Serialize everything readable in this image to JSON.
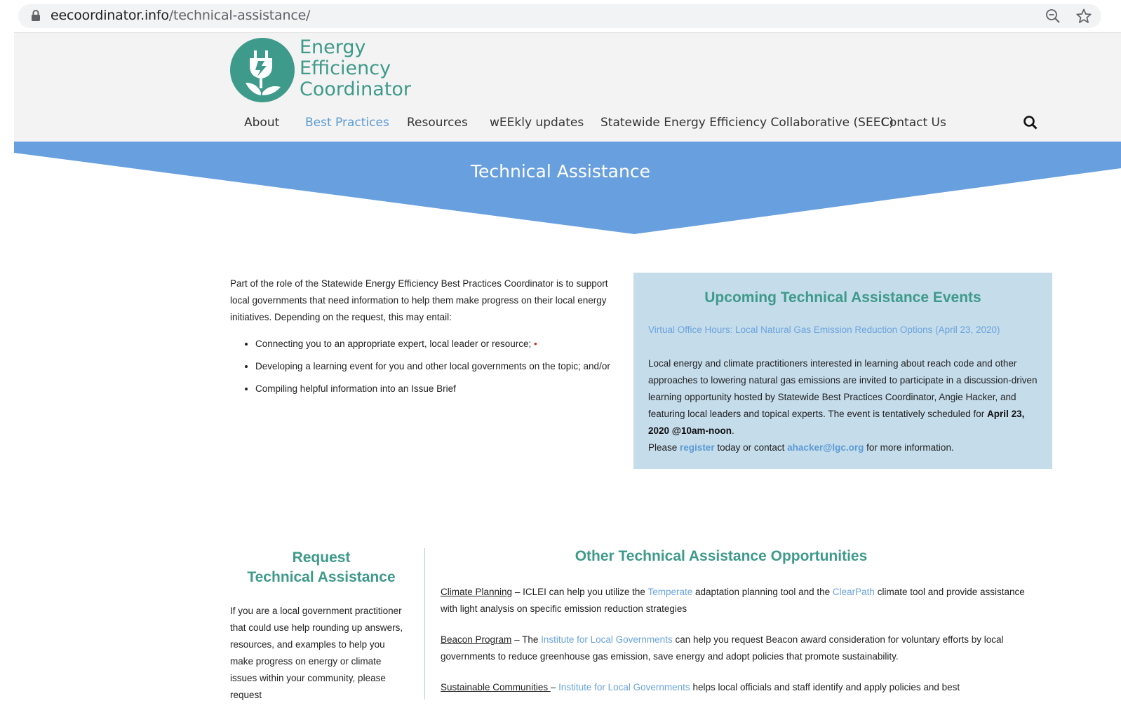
{
  "browser": {
    "url_domain": "eecoordinator.info",
    "url_path": "/technical-assistance/",
    "icons": [
      "lock-icon",
      "zoom-out-icon",
      "star-icon"
    ]
  },
  "header": {
    "logo_line1": "Energy",
    "logo_line2": "Efficiency",
    "logo_line3": "Coordinator",
    "nav": [
      {
        "label": "About"
      },
      {
        "label": "Best Practices",
        "active": true
      },
      {
        "label": "Resources"
      },
      {
        "label": "wEEkly updates"
      },
      {
        "label": "Statewide Energy Efficiency Collaborative (SEEC)"
      },
      {
        "label": "Contact Us"
      }
    ],
    "accent_color": "#3e9a8a",
    "active_nav_color": "#5b9bd5"
  },
  "banner": {
    "title": "Technical Assistance",
    "color": "#689fde"
  },
  "intro": {
    "paragraph": "Part of the role of the Statewide Energy Efficiency Best Practices Coordinator is to support local governments that need information to help them make progress on their local energy initiatives. Depending on the request, this may entail:",
    "bullets": [
      "Connecting you to an appropriate expert, local leader or resource;",
      "Developing a learning event for you and other local governments on the topic; and/or",
      "Compiling helpful information into an Issue Brief"
    ]
  },
  "events": {
    "title": "Upcoming Technical Assistance Events",
    "event_link": "Virtual Office Hours: Local Natural Gas Emission Reduction Options (April 23, 2020)",
    "body_text": "Local energy and climate practitioners interested in learning about reach code and other approaches to lowering natural gas emissions are invited to participate in a discussion-driven learning opportunity hosted by Statewide Best Practices Coordinator, Angie Hacker, and featuring local leaders and topical experts. The event is tentatively scheduled for",
    "date_bold": "April 23, 2020 @10am-noon",
    "period": ".",
    "please": "Please",
    "register": "register",
    "today_contact": "today or contact",
    "email": "ahacker@lgc.org",
    "more_info": "for more information.",
    "box_color": "#c5dcea"
  },
  "request": {
    "title_line1": "Request",
    "title_line2": "Technical Assistance",
    "body": "If you are a local government practitioner that could use help rounding up answers, resources, and examples to help you make progress on energy or climate issues within your community, please request"
  },
  "other": {
    "title": "Other Technical Assistance Opportunities",
    "climate": {
      "label": "Climate Planning",
      "t1": " – ICLEI can help you utilize the ",
      "link1": "Temperate",
      "t2": " adaptation planning tool and the ",
      "link2": "ClearPath",
      "t3": " climate tool and provide assistance with light analysis on specific emission reduction strategies"
    },
    "beacon": {
      "label": "Beacon Program",
      "t1": " – The ",
      "link1": "Institute for Local Governments",
      "t2": " can help you request Beacon award consideration for voluntary efforts by local governments to reduce greenhouse gas emission, save energy and adopt policies that promote sustainability."
    },
    "sustainable": {
      "label": "Sustainable Communities ",
      "t1": "– ",
      "link1": "Institute for Local Governments",
      "t2": " helps local officials and staff identify and apply policies and best"
    }
  }
}
